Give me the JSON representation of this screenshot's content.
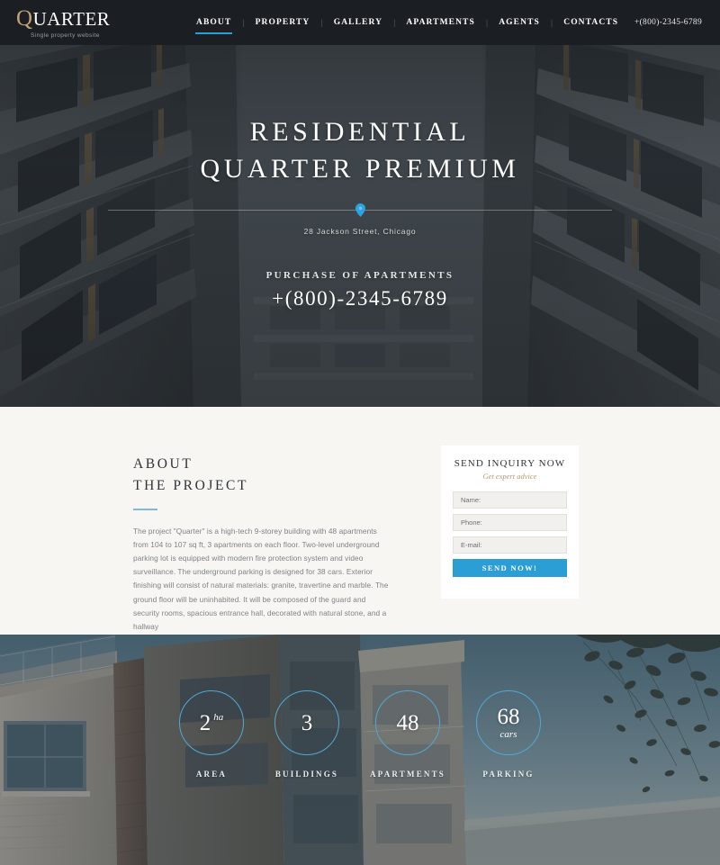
{
  "header": {
    "logo": {
      "first_letter": "Q",
      "rest": "UARTER",
      "tagline": "Single property website"
    },
    "nav": [
      {
        "label": "ABOUT",
        "active": true
      },
      {
        "label": "PROPERTY",
        "active": false
      },
      {
        "label": "GALLERY",
        "active": false
      },
      {
        "label": "APARTMENTS",
        "active": false
      },
      {
        "label": "AGENTS",
        "active": false
      },
      {
        "label": "CONTACTS",
        "active": false
      }
    ],
    "separator": "|",
    "phone": "+(800)-2345-6789"
  },
  "hero": {
    "title_line1": "RESIDENTIAL",
    "title_line2": "QUARTER PREMIUM",
    "pin_icon": "map-pin-icon",
    "address": "28 Jackson Street,  Chicago",
    "purchase_label": "PURCHASE OF APARTMENTS",
    "purchase_phone": "+(800)-2345-6789"
  },
  "about": {
    "heading_line1": "ABOUT",
    "heading_line2": "THE PROJECT",
    "body": "The project \"Quarter\" is a high-tech 9-storey building with 48 apartments from 104 to 107 sq ft, 3 apartments on each floor. Two-level underground parking lot is equipped with modern fire protection system and video surveillance. The underground parking is designed for 38 cars. Exterior finishing will consist of natural materials: granite, travertine and marble. The ground floor will be uninhabited. It will be composed of the guard and security rooms, spacious entrance hall, decorated with natural stone, and a hallway"
  },
  "inquiry_form": {
    "title": "SEND INQUIRY NOW",
    "subtitle": "Get expert advice",
    "fields": [
      {
        "name": "name",
        "placeholder": "Name:",
        "value": ""
      },
      {
        "name": "phone",
        "placeholder": "Phone:",
        "value": ""
      },
      {
        "name": "email",
        "placeholder": "E-mail:",
        "value": ""
      }
    ],
    "submit_label": "SEND NOW!"
  },
  "stats": [
    {
      "value": "2",
      "unit": "ha",
      "unit_position": "sup",
      "label": "AREA"
    },
    {
      "value": "3",
      "unit": "",
      "unit_position": "none",
      "label": "BUILDINGS"
    },
    {
      "value": "48",
      "unit": "",
      "unit_position": "none",
      "label": "APARTMENTS"
    },
    {
      "value": "68",
      "unit": "cars",
      "unit_position": "below",
      "label": "PARKING"
    }
  ],
  "colors": {
    "header_bg": "#1b1f24",
    "accent_blue": "#2c9ed6",
    "circle_blue": "#4fa9d8",
    "logo_gold": "#c4a373",
    "about_bg": "#f8f6f2",
    "subtitle_gold": "#b09a76"
  }
}
